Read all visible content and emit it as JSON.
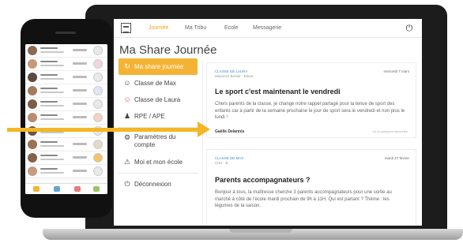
{
  "nav": {
    "items": [
      "Journée",
      "Ma Tribu",
      "Ecole",
      "Messagerie"
    ],
    "active_index": 0
  },
  "page_title": "Ma Share Journée",
  "sidebar": {
    "items": [
      {
        "label": "Ma share journée",
        "icon": "refresh-icon",
        "active": true
      },
      {
        "label": "Classe de Max",
        "icon": "child-icon",
        "active": false
      },
      {
        "label": "Classe de Laura",
        "icon": "child-icon",
        "active": false
      },
      {
        "label": "RPE / APE",
        "icon": "people-icon",
        "active": false
      },
      {
        "label": "Paramètres du compte",
        "icon": "gear-icon",
        "active": false
      },
      {
        "label": "Moi et mon école",
        "icon": "school-icon",
        "active": false
      },
      {
        "label": "Déconnexion",
        "icon": "power-icon",
        "active": false
      }
    ]
  },
  "posts": [
    {
      "source": "CLASSE DE LAURA",
      "subtitle": "Maxence Bertier - Bleue",
      "date": "mercredi 7 mars",
      "title": "Le sport c'est maintenant le vendredi",
      "body": "Chers parents de la classe, je change notre rappel partagé pour la tenue de sport des enfants car à partir de la semaine prochaine le jour de sport sera le vendredi et non plus le lundi !",
      "author": "Gaëlle Delannis",
      "seen": "Vu la quelques secondes"
    },
    {
      "source": "CLASSE DE MAX",
      "subtitle": "CM1 - B",
      "date": "mardi 27 février",
      "title": "Parents accompagnateurs ?",
      "body": "Bonjour à tous, la maîtresse cherche 3 parents accompagnateurs pour une sortie au marché à côté de l'école mardi prochain de 9h à 11H. Qui est partant ? Thème : les légumes de la saison."
    }
  ],
  "colors": {
    "accent": "#f5b335",
    "arrow": "#f3b624",
    "link": "#3a8ed0"
  }
}
